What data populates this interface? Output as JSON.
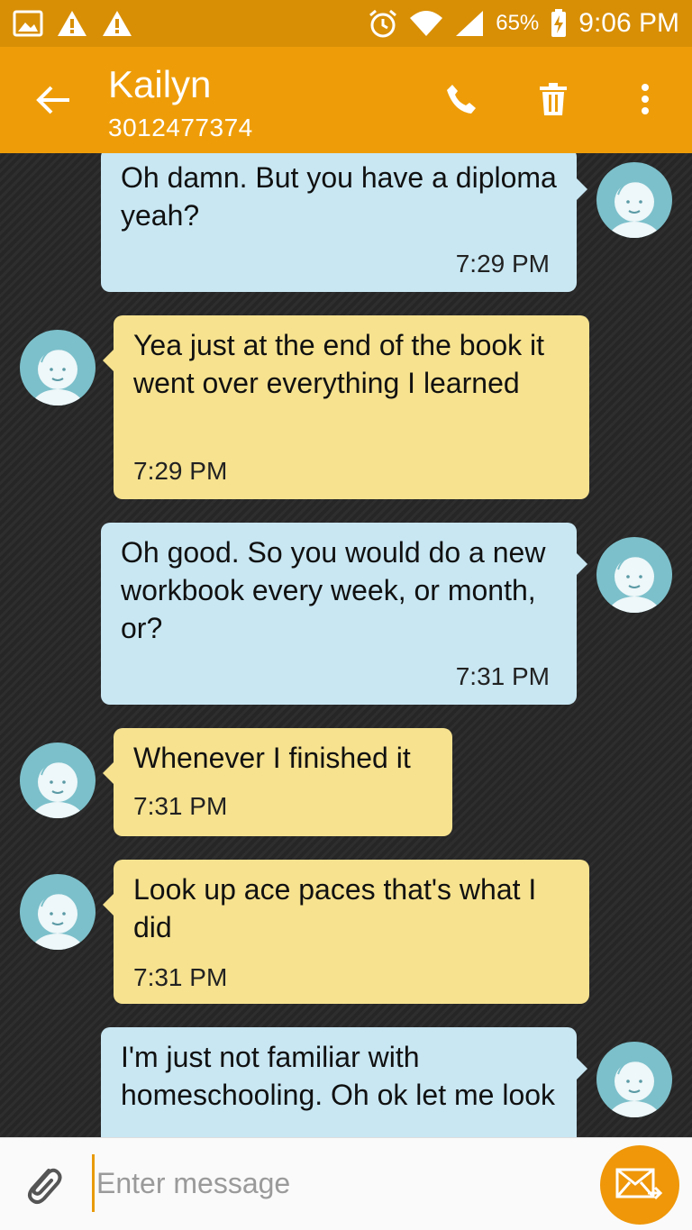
{
  "status_bar": {
    "battery": "65%",
    "time": "9:06 PM",
    "icons": [
      "gallery-icon",
      "warning-icon",
      "warning-icon",
      "alarm-icon",
      "wifi-icon",
      "signal-icon",
      "charging-icon"
    ]
  },
  "header": {
    "contact_name": "Kailyn",
    "contact_number": "3012477374",
    "icons": [
      "back-arrow-icon",
      "phone-icon",
      "trash-icon",
      "more-vert-icon"
    ]
  },
  "messages": [
    {
      "direction": "sent",
      "text": "Oh damn. But you have a diploma yeah?",
      "time": "7:29 PM"
    },
    {
      "direction": "received",
      "text": "Yea just at the end of the book it went over everything I learned",
      "time": "7:29 PM"
    },
    {
      "direction": "sent",
      "text": "Oh good. So you would do a new workbook every week, or month, or?",
      "time": "7:31 PM"
    },
    {
      "direction": "received",
      "text": "Whenever I finished it",
      "time": "7:31 PM"
    },
    {
      "direction": "received",
      "text": "Look up ace paces that's what I did",
      "time": "7:31 PM"
    },
    {
      "direction": "sent",
      "text": "I'm just not familiar with homeschooling. Oh ok let me look",
      "time": ""
    }
  ],
  "composer": {
    "placeholder": "Enter message",
    "value": ""
  },
  "colors": {
    "status_bar": "#d88f06",
    "app_bar": "#ee9d09",
    "sent_bubble": "#c8e7f3",
    "received_bubble": "#f6e28f",
    "avatar": "#7cc0cb",
    "send_button": "#ef9709"
  }
}
